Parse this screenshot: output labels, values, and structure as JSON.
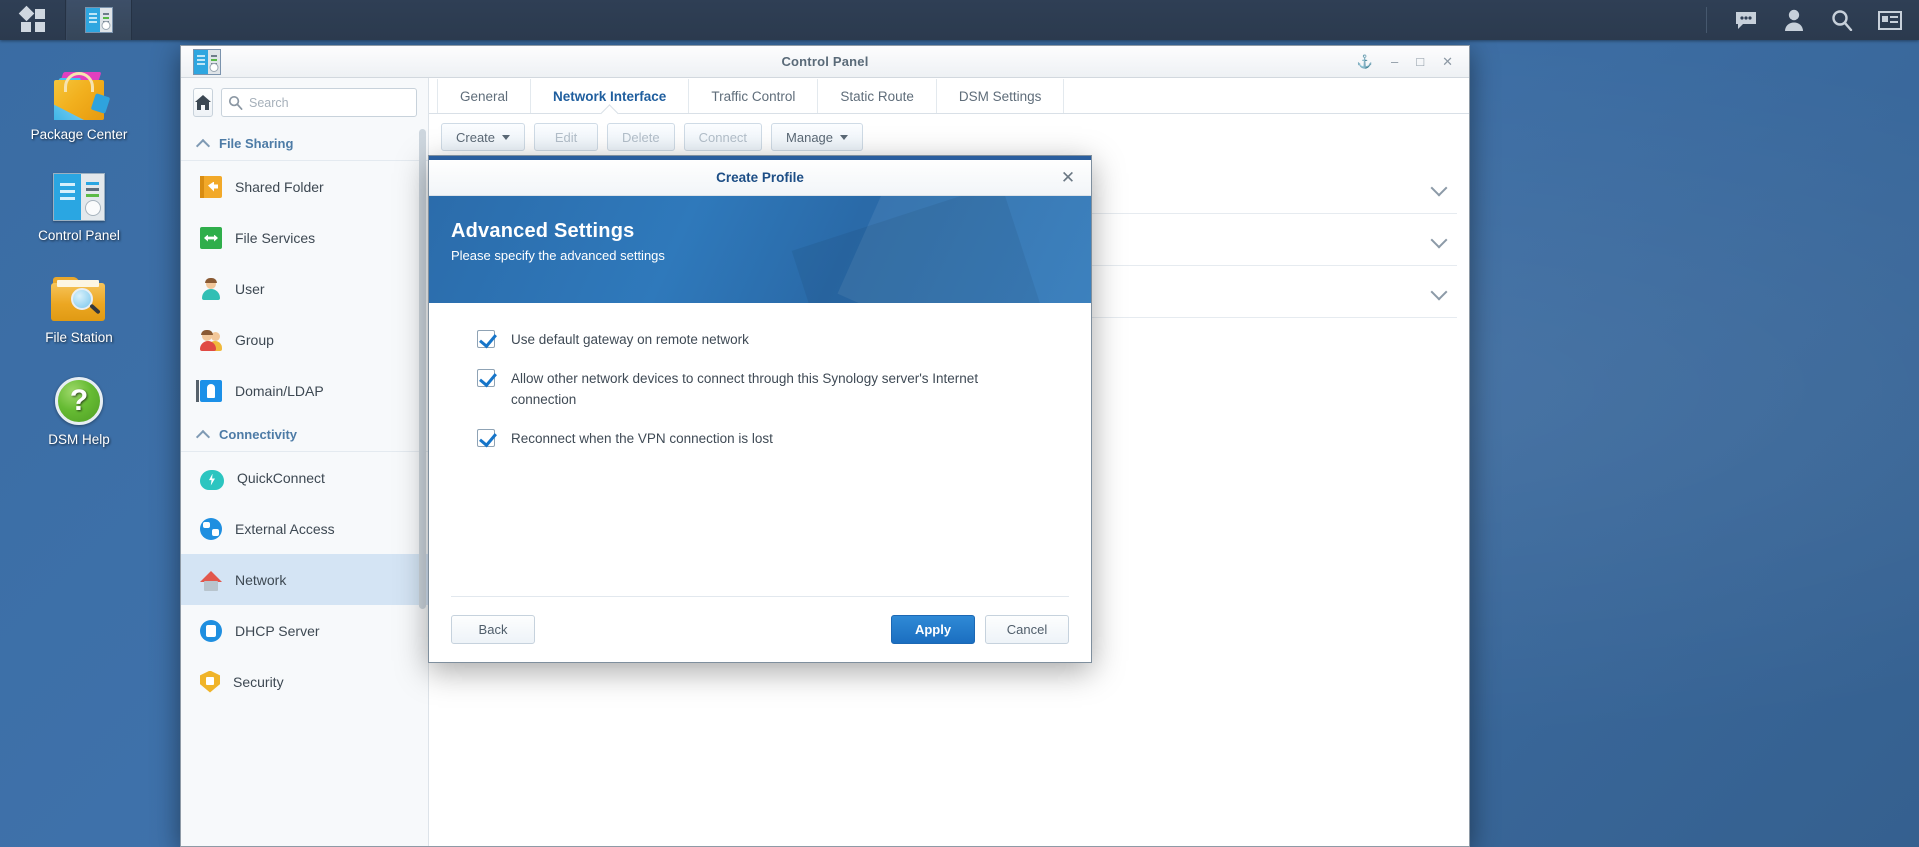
{
  "taskbar": {
    "app_grid_icon": "app-grid-icon",
    "open_apps": [
      {
        "name": "control-panel",
        "icon": "control-panel-icon"
      }
    ],
    "right_icons": [
      {
        "name": "notifications-icon",
        "glyph": "speech-bubble"
      },
      {
        "name": "user-account-icon",
        "glyph": "person"
      },
      {
        "name": "search-icon",
        "glyph": "magnifier"
      },
      {
        "name": "widgets-icon",
        "glyph": "id-card"
      }
    ]
  },
  "desktop": {
    "icons": [
      {
        "label": "Package Center",
        "icon": "package-center-icon"
      },
      {
        "label": "Control Panel",
        "icon": "control-panel-icon"
      },
      {
        "label": "File Station",
        "icon": "file-station-icon"
      },
      {
        "label": "DSM Help",
        "icon": "dsm-help-icon",
        "glyph": "?"
      }
    ]
  },
  "window": {
    "title": "Control Panel",
    "icon": "control-panel-icon",
    "buttons": {
      "pin": "⚓",
      "minimize": "–",
      "maximize": "□",
      "close": "✕"
    }
  },
  "sidebar": {
    "home_icon": "home-icon",
    "search": {
      "placeholder": "Search",
      "value": ""
    },
    "groups": [
      {
        "label": "File Sharing",
        "items": [
          {
            "label": "Shared Folder",
            "icon": "shared-folder-icon"
          },
          {
            "label": "File Services",
            "icon": "file-services-icon"
          },
          {
            "label": "User",
            "icon": "user-icon"
          },
          {
            "label": "Group",
            "icon": "group-icon"
          },
          {
            "label": "Domain/LDAP",
            "icon": "domain-ldap-icon"
          }
        ]
      },
      {
        "label": "Connectivity",
        "items": [
          {
            "label": "QuickConnect",
            "icon": "quickconnect-icon"
          },
          {
            "label": "External Access",
            "icon": "external-access-icon"
          },
          {
            "label": "Network",
            "icon": "network-icon",
            "active": true
          },
          {
            "label": "DHCP Server",
            "icon": "dhcp-server-icon"
          },
          {
            "label": "Security",
            "icon": "security-icon"
          }
        ]
      }
    ]
  },
  "main": {
    "tabs": [
      {
        "label": "General",
        "active": false
      },
      {
        "label": "Network Interface",
        "active": true
      },
      {
        "label": "Traffic Control",
        "active": false
      },
      {
        "label": "Static Route",
        "active": false
      },
      {
        "label": "DSM Settings",
        "active": false
      }
    ],
    "toolbar": [
      {
        "label": "Create",
        "disabled": false,
        "has_caret": true
      },
      {
        "label": "Edit",
        "disabled": true,
        "has_caret": false
      },
      {
        "label": "Delete",
        "disabled": true,
        "has_caret": false
      },
      {
        "label": "Connect",
        "disabled": true,
        "has_caret": false
      },
      {
        "label": "Manage",
        "disabled": false,
        "has_caret": true
      }
    ],
    "rows": [
      {
        "chevron": "chevron-down-icon"
      },
      {
        "chevron": "chevron-down-icon"
      },
      {
        "chevron": "chevron-down-icon"
      }
    ]
  },
  "modal": {
    "title": "Create Profile",
    "close_label": "✕",
    "hero_title": "Advanced Settings",
    "hero_subtitle": "Please specify the advanced settings",
    "checkboxes": [
      {
        "label": "Use default gateway on remote network",
        "checked": true
      },
      {
        "label": "Allow other network devices to connect through this Synology server's Internet connection",
        "checked": true
      },
      {
        "label": "Reconnect when the VPN connection is lost",
        "checked": true
      }
    ],
    "footer": {
      "back": "Back",
      "apply": "Apply",
      "cancel": "Cancel"
    }
  },
  "colors": {
    "accent": "#1d4e86",
    "hero_blue": "#2f79bb",
    "primary_button": "#1b6ec0",
    "active_tab": "#1f5e9e",
    "sidebar_active": "#d4e4f4"
  }
}
